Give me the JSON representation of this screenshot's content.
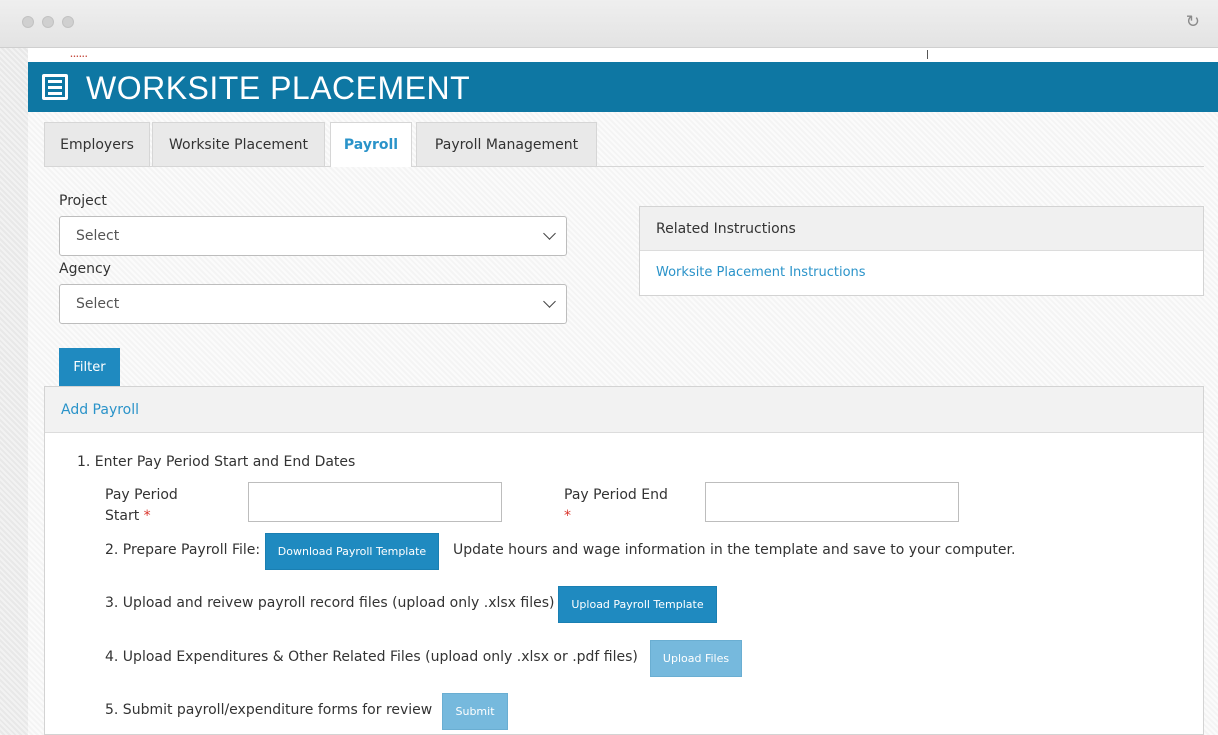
{
  "header": {
    "title": "WORKSITE PLACEMENT"
  },
  "tabs": [
    {
      "label": "Employers"
    },
    {
      "label": "Worksite Placement"
    },
    {
      "label": "Payroll"
    },
    {
      "label": "Payroll Management"
    }
  ],
  "form": {
    "project_label": "Project",
    "project_value": "Select",
    "agency_label": "Agency",
    "agency_value": "Select",
    "filter_label": "Filter"
  },
  "instructions": {
    "title": "Related Instructions",
    "link": "Worksite Placement Instructions"
  },
  "payroll": {
    "title": "Add Payroll",
    "step1": "1. Enter Pay Period Start and End Dates",
    "start_label_1": "Pay Period",
    "start_label_2": "Start",
    "end_label": "Pay Period End",
    "required_mark": "*",
    "step2": "2. Prepare Payroll File:",
    "download_btn": "Download Payroll Template",
    "step2_note": "Update hours and wage information in the template and save to your computer.",
    "step3": "3. Upload and reivew payroll record files (upload only .xlsx files)",
    "upload_template_btn": "Upload Payroll Template",
    "step4": "4. Upload Expenditures & Other Related Files (upload only .xlsx or .pdf files)",
    "upload_files_btn": "Upload Files",
    "step5": "5. Submit payroll/expenditure forms for review",
    "submit_btn": "Submit"
  },
  "icons": [
    "list-icon",
    "reload-icon",
    "chevron-down-icon"
  ]
}
